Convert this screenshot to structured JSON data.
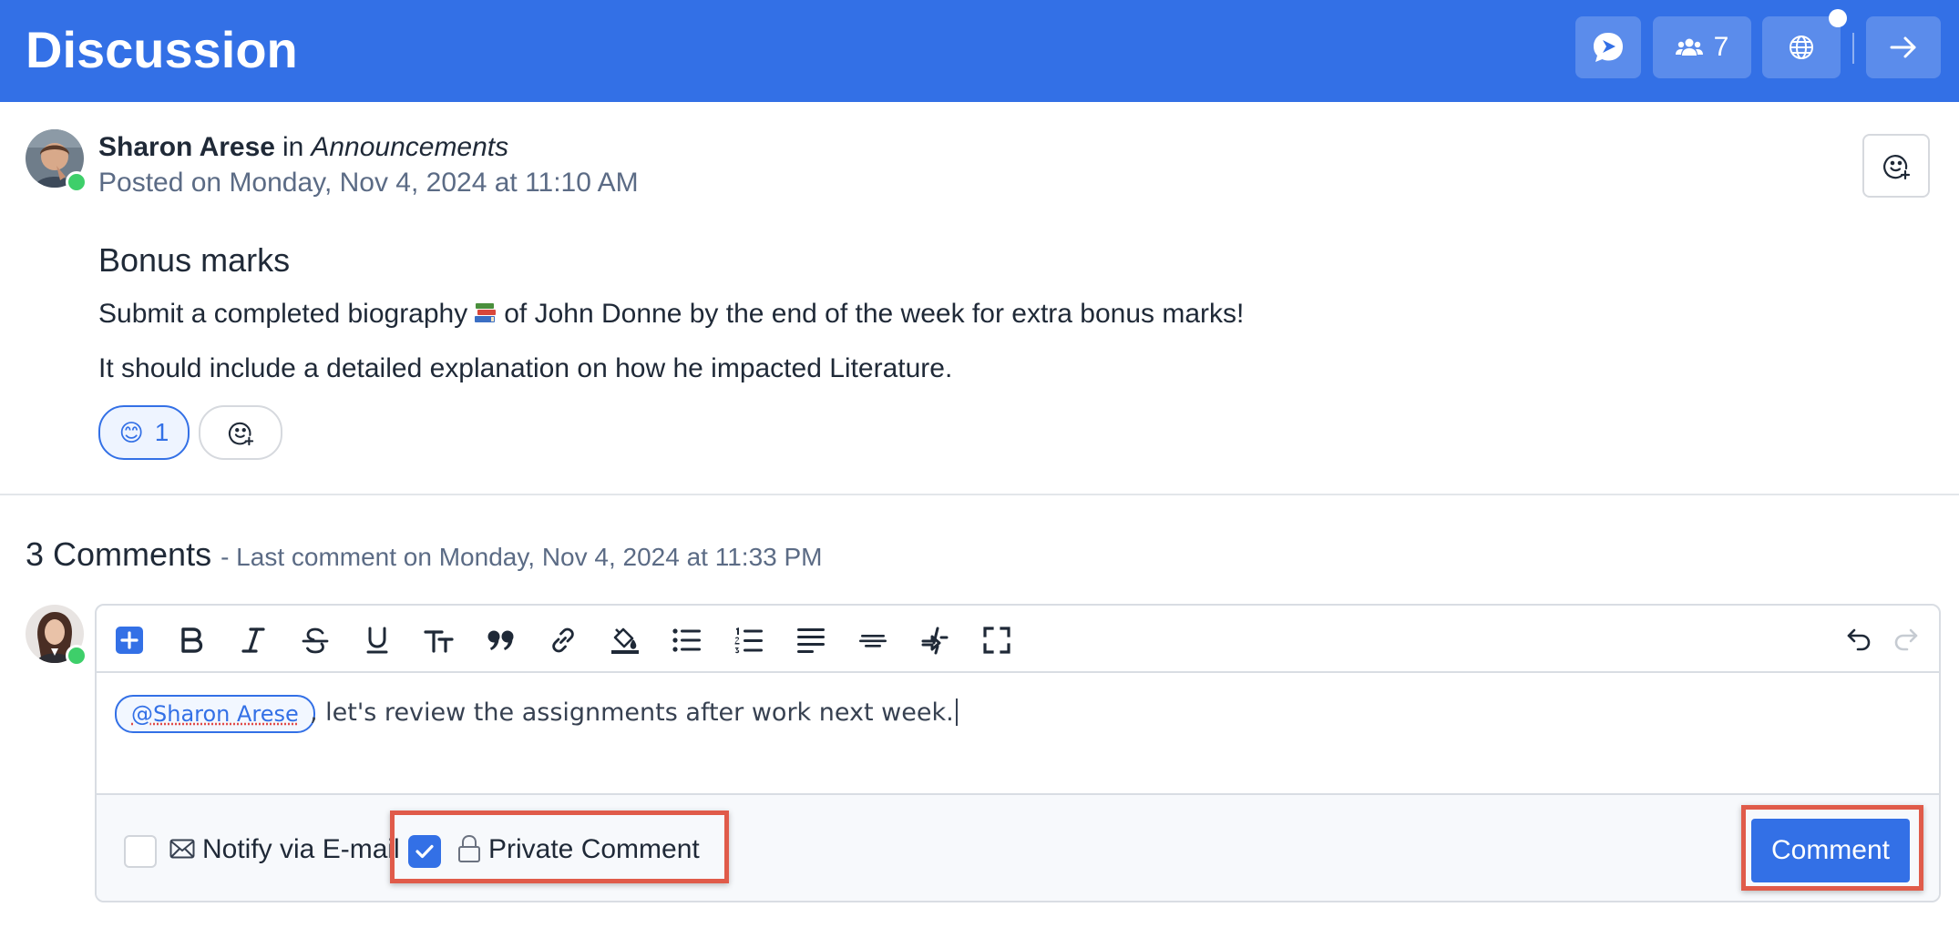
{
  "header": {
    "title": "Discussion",
    "participants_count": "7"
  },
  "post": {
    "author": "Sharon Arese",
    "in_label": "in",
    "forum": "Announcements",
    "posted": "Posted on Monday, Nov 4, 2024 at 11:10 AM",
    "title": "Bonus marks",
    "body_line1_before": "Submit a completed biography",
    "body_line1_after": "of John Donne by the end of the week for extra bonus marks!",
    "body_line2": "It should include a detailed explanation on how he impacted Literature.",
    "reaction_emoji": "😊",
    "reaction_count": "1"
  },
  "comments": {
    "count_label": "3 Comments",
    "last_comment": "- Last comment on Monday, Nov 4, 2024 at 11:33 PM"
  },
  "editor": {
    "mention": "@Sharon Arese",
    "text": ", let's review the assignments after work next week.",
    "notify_label": "Notify via E-mail",
    "notify_checked": false,
    "private_label": "Private Comment",
    "private_checked": true,
    "submit_label": "Comment"
  },
  "colors": {
    "brand": "#3370e6",
    "highlight": "#e05b4a",
    "online": "#3ecf6a"
  }
}
